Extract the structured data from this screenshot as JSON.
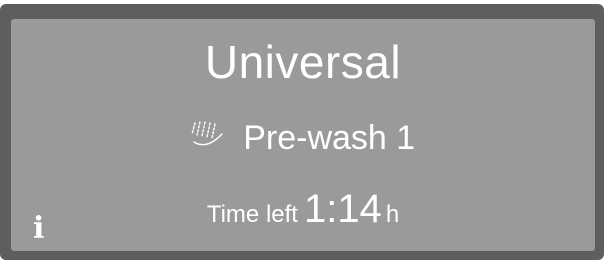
{
  "display": {
    "program_name": "Universal",
    "stage": {
      "icon": "pre-wash-spray-icon",
      "label": "Pre-wash 1"
    },
    "time_left": {
      "label": "Time left",
      "value": "1:14",
      "unit": "h"
    },
    "info": {
      "icon": "info-icon",
      "glyph": "i"
    }
  },
  "colors": {
    "bezel": "#5e5e5e",
    "screen_background": "#9a9a9a",
    "text": "#ffffff"
  }
}
